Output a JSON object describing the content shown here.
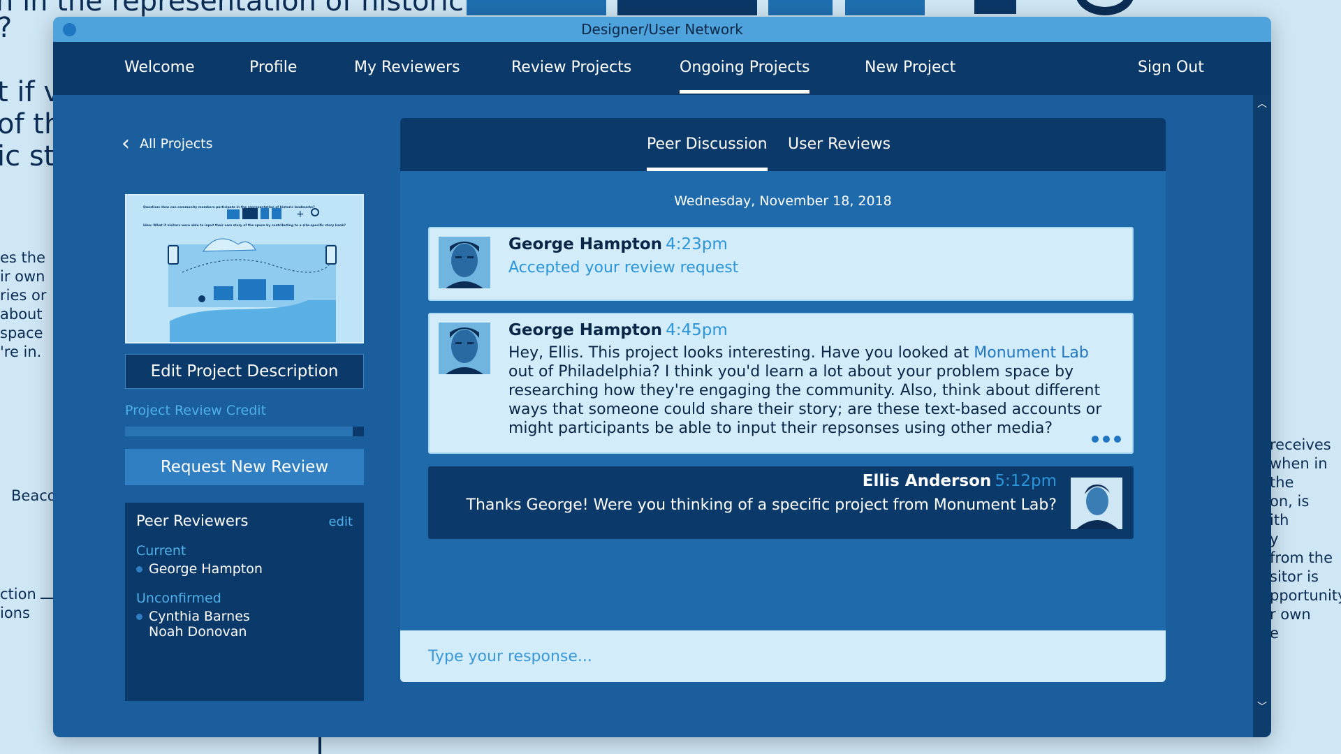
{
  "background": {
    "lines_top": [
      "n in the representation of historic",
      "?"
    ],
    "lines_left": [
      "t if vi",
      "of th",
      "ic sto"
    ],
    "left_small": [
      "es the",
      "ir own",
      "ries or",
      "about",
      "space",
      "'re in."
    ],
    "beacon": "Beaco",
    "left_bottom": [
      "ction",
      "ions"
    ],
    "right_small": [
      "receives",
      "when in",
      "the",
      "on, is",
      "ith",
      "y",
      "from the",
      "sitor is",
      "pportunity",
      "r own",
      "e"
    ]
  },
  "window": {
    "title": "Designer/User Network"
  },
  "nav": {
    "items": [
      "Welcome",
      "Profile",
      "My Reviewers",
      "Review Projects",
      "Ongoing Projects",
      "New Project"
    ],
    "active": "Ongoing Projects",
    "sign_out": "Sign Out"
  },
  "sidebar": {
    "back_label": "All Projects",
    "edit_button": "Edit Project Description",
    "credit_label": "Project Review Credit",
    "credit_progress": 0.95,
    "request_button": "Request New Review",
    "peer_title": "Peer Reviewers",
    "peer_edit": "edit",
    "current_label": "Current",
    "current": [
      "George Hampton"
    ],
    "unconfirmed_label": "Unconfirmed",
    "unconfirmed": [
      "Cynthia Barnes",
      "Noah Donovan"
    ]
  },
  "thumbnail": {
    "question": "Question: How can community members participate in the representation of historic landmarks?",
    "idea": "Idea: What if visitors were able to input their own story of the space by contributing to a site-specific story bank?"
  },
  "panel": {
    "tabs": [
      "Peer Discussion",
      "User Reviews"
    ],
    "active_tab": "Peer Discussion",
    "date": "Wednesday, November 18, 2018",
    "messages": [
      {
        "author": "George Hampton",
        "time": "4:23pm",
        "text": "Accepted your review request"
      },
      {
        "author": "George Hampton",
        "time": "4:45pm",
        "text_before": "Hey, Ellis. This project looks interesting. Have you looked at ",
        "link": "Monument Lab",
        "text_after": " out of Philadelphia? I think you'd learn a lot about your problem space by researching how they're engaging the community. Also, think about different ways that someone could share their story; are these text-based accounts or might participants be able to input their repsonses using other media?"
      },
      {
        "author": "Ellis Anderson",
        "time": "5:12pm",
        "text": "Thanks George! Were you thinking of a specific project from Monument Lab?"
      }
    ],
    "input_placeholder": "Type your response..."
  },
  "colors": {
    "window_bg": "#1a5e9d",
    "nav_bg": "#0b3a6a",
    "accent": "#2b95d8",
    "message_bg": "#d2ecfa"
  }
}
